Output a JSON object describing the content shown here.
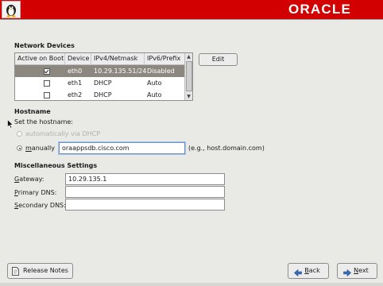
{
  "header": {
    "brand": "ORACLE",
    "logo_icon": "installer-logo-icon"
  },
  "network": {
    "title": "Network Devices",
    "columns": [
      "Active on Boot",
      "Device",
      "IPv4/Netmask",
      "IPv6/Prefix"
    ],
    "rows": [
      {
        "active": true,
        "device": "eth0",
        "ipv4": "10.29.135.51/24",
        "ipv6": "Disabled",
        "selected": true
      },
      {
        "active": false,
        "device": "eth1",
        "ipv4": "DHCP",
        "ipv6": "Auto",
        "selected": false
      },
      {
        "active": false,
        "device": "eth2",
        "ipv4": "DHCP",
        "ipv6": "Auto",
        "selected": false
      }
    ],
    "edit_label": "Edit"
  },
  "hostname": {
    "title": "Hostname",
    "prompt": "Set the hostname:",
    "auto_label": "automatically via DHCP",
    "manual_label_prefix": "",
    "manual_label_ul": "m",
    "manual_label_rest": "anually",
    "manual_value": "oraappsdb.cisco.com",
    "example": "(e.g., host.domain.com)"
  },
  "misc": {
    "title": "Miscellaneous Settings",
    "gateway_ul": "G",
    "gateway_rest": "ateway:",
    "gateway_value": "10.29.135.1",
    "primary_ul": "P",
    "primary_rest": "rimary DNS:",
    "primary_value": "",
    "secondary_ul": "S",
    "secondary_rest": "econdary DNS:",
    "secondary_value": ""
  },
  "footer": {
    "release_notes": "Release Notes",
    "back_ul": "B",
    "back_rest": "ack",
    "next_ul": "N",
    "next_rest": "ext"
  },
  "colors": {
    "brand_red": "#d20000",
    "selection": "#8c8880",
    "background": "#e9e9e6"
  }
}
